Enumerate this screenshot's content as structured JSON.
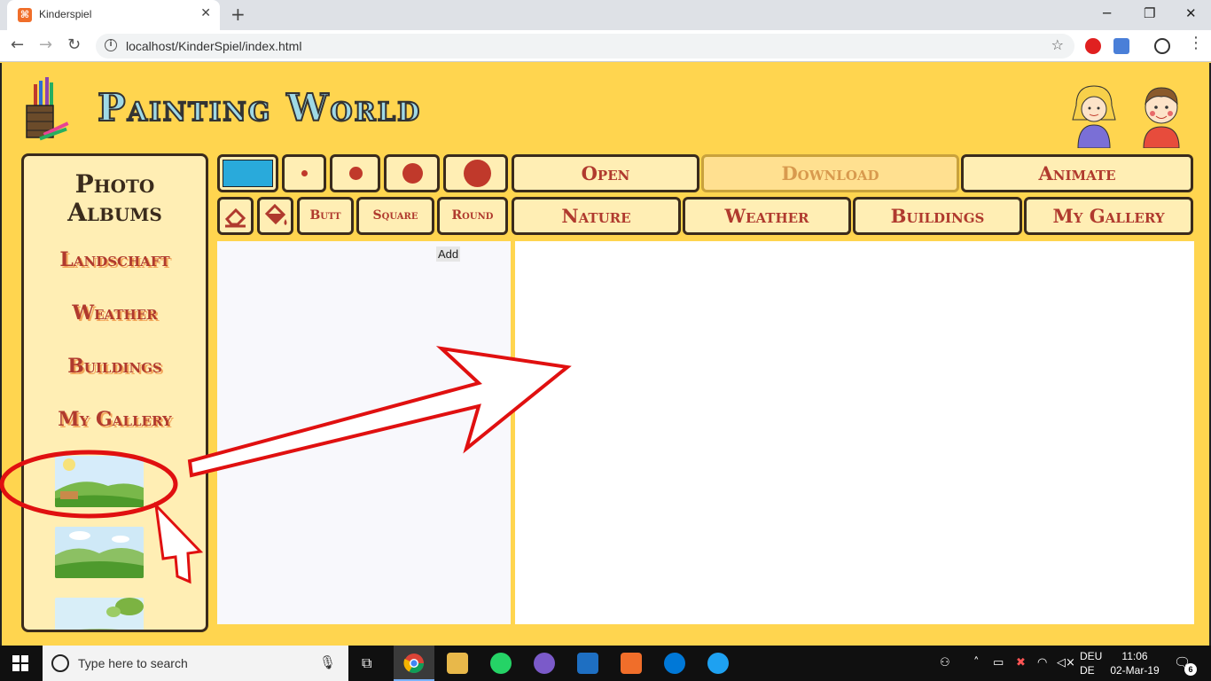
{
  "browser": {
    "tab_title": "Kinderspiel",
    "url": "localhost/KinderSpiel/index.html"
  },
  "app": {
    "title": "Painting World",
    "colors": {
      "background": "#ffd54f",
      "panel": "#ffeeb4",
      "accent": "#b03a2e",
      "border": "#3a2b1c",
      "swatch": "#29aadb"
    }
  },
  "sidebar": {
    "title_line1": "Photo",
    "title_line2": "Albums",
    "links": [
      "Landschaft",
      "Weather",
      "Buildings",
      "My Gallery"
    ]
  },
  "toolbar": {
    "top_buttons": {
      "open": "Open",
      "download": "Download",
      "animate": "Animate"
    },
    "line_caps": {
      "butt": "Butt",
      "square": "Square",
      "round": "Round"
    },
    "categories": [
      "Nature",
      "Weather",
      "Buildings",
      "My Gallery"
    ]
  },
  "left_panel": {
    "add_label": "Add"
  },
  "taskbar": {
    "search_placeholder": "Type here to search",
    "lang_line1": "DEU",
    "lang_line2": "DE",
    "time": "11:06",
    "date": "02-Mar-19",
    "notifications": "6"
  }
}
